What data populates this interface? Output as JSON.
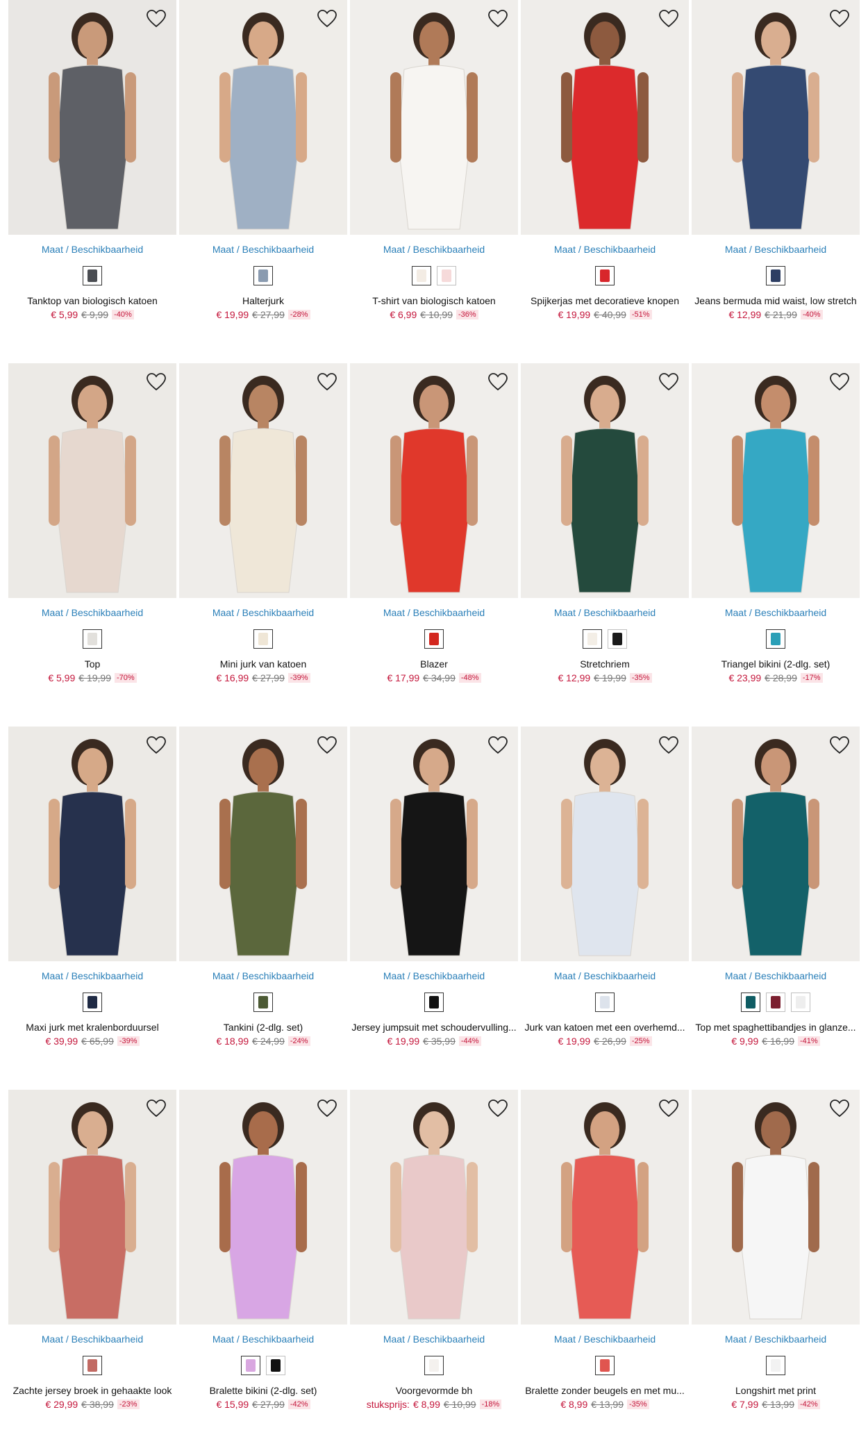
{
  "size_label": "Maat / Beschikbaarheid",
  "products": [
    {
      "name": "Tanktop van biologisch katoen",
      "price": "€ 5,99",
      "old_price": "€ 9,99",
      "discount": "-40%",
      "swatches": [
        "#4a4d52"
      ],
      "bg": "#e9e7e4",
      "fig": "#5e6066",
      "skin": "#c99a7a"
    },
    {
      "name": "Halterjurk",
      "price": "€ 19,99",
      "old_price": "€ 27,99",
      "discount": "-28%",
      "swatches": [
        "#8a9bb0"
      ],
      "bg": "#efede9",
      "fig": "#9fb0c4",
      "skin": "#d7a988"
    },
    {
      "name": "T-shirt van biologisch katoen",
      "price": "€ 6,99",
      "old_price": "€ 10,99",
      "discount": "-36%",
      "swatches": [
        "#f3ece4",
        "#f6dada"
      ],
      "bg": "#f0eeeb",
      "fig": "#f7f5f2",
      "skin": "#b07a58"
    },
    {
      "name": "Spijkerjas met decoratieve knopen",
      "price": "€ 19,99",
      "old_price": "€ 40,99",
      "discount": "-51%",
      "swatches": [
        "#d8262b"
      ],
      "bg": "#efedea",
      "fig": "#dc2a2c",
      "skin": "#8d5a3f"
    },
    {
      "name": "Jeans bermuda mid waist, low stretch",
      "price": "€ 12,99",
      "old_price": "€ 21,99",
      "discount": "-40%",
      "swatches": [
        "#2d3e63"
      ],
      "bg": "#efedea",
      "fig": "#344a72",
      "skin": "#d9ae90"
    },
    {
      "name": "Top",
      "price": "€ 5,99",
      "old_price": "€ 19,99",
      "discount": "-70%",
      "swatches": [
        "#e2e0dc"
      ],
      "bg": "#eceae6",
      "fig": "#e6d8cf",
      "skin": "#d3a687"
    },
    {
      "name": "Mini jurk van katoen",
      "price": "€ 16,99",
      "old_price": "€ 27,99",
      "discount": "-39%",
      "swatches": [
        "#efe6d6"
      ],
      "bg": "#efedea",
      "fig": "#efe7d8",
      "skin": "#b88563"
    },
    {
      "name": "Blazer",
      "price": "€ 17,99",
      "old_price": "€ 34,99",
      "discount": "-48%",
      "swatches": [
        "#d3271f"
      ],
      "bg": "#f0eeeb",
      "fig": "#e0382b",
      "skin": "#c99677"
    },
    {
      "name": "Stretchriem",
      "price": "€ 12,99",
      "old_price": "€ 19,99",
      "discount": "-35%",
      "swatches": [
        "#f3eee6",
        "#1a1a1a"
      ],
      "bg": "#efedea",
      "fig": "#244a3d",
      "skin": "#d8ac8e"
    },
    {
      "name": "Triangel bikini (2-dlg. set)",
      "price": "€ 23,99",
      "old_price": "€ 28,99",
      "discount": "-17%",
      "swatches": [
        "#2a9fb7"
      ],
      "bg": "#f1efec",
      "fig": "#35a8c4",
      "skin": "#c48d6c"
    },
    {
      "name": "Maxi jurk met kralenborduursel",
      "price": "€ 39,99",
      "old_price": "€ 65,99",
      "discount": "-39%",
      "swatches": [
        "#1f2a44"
      ],
      "bg": "#eceae6",
      "fig": "#26314d",
      "skin": "#d6a988"
    },
    {
      "name": "Tankini (2-dlg. set)",
      "price": "€ 18,99",
      "old_price": "€ 24,99",
      "discount": "-24%",
      "swatches": [
        "#4c5a34"
      ],
      "bg": "#efedea",
      "fig": "#5b673c",
      "skin": "#a9704e"
    },
    {
      "name": "Jersey jumpsuit met schoudervulling...",
      "price": "€ 19,99",
      "old_price": "€ 35,99",
      "discount": "-44%",
      "swatches": [
        "#111111"
      ],
      "bg": "#f0eeeb",
      "fig": "#151515",
      "skin": "#d6a98a"
    },
    {
      "name": "Jurk van katoen met een overhemd...",
      "price": "€ 19,99",
      "old_price": "€ 26,99",
      "discount": "-25%",
      "swatches": [
        "#dde3ec"
      ],
      "bg": "#efedea",
      "fig": "#dfe5ee",
      "skin": "#dcb395"
    },
    {
      "name": "Top met spaghettibandjes in glanze...",
      "price": "€ 9,99",
      "old_price": "€ 16,99",
      "discount": "-41%",
      "swatches": [
        "#0f5c63",
        "#7b1f2f",
        "#eeeeee"
      ],
      "bg": "#efedea",
      "fig": "#136169",
      "skin": "#c99677"
    },
    {
      "name": "Zachte jersey broek in gehaakte look",
      "price": "€ 29,99",
      "old_price": "€ 38,99",
      "discount": "-23%",
      "swatches": [
        "#c26a63"
      ],
      "bg": "#eceae6",
      "fig": "#c86d64",
      "skin": "#d9ae90"
    },
    {
      "name": "Bralette bikini (2-dlg. set)",
      "price": "€ 15,99",
      "old_price": "€ 27,99",
      "discount": "-42%",
      "swatches": [
        "#d9a7e0",
        "#111111"
      ],
      "bg": "#efedea",
      "fig": "#d8a6e4",
      "skin": "#a86c4b"
    },
    {
      "name": "Voorgevormde bh",
      "prefix": "stuksprijs:",
      "price": "€ 8,99",
      "old_price": "€ 10,99",
      "discount": "-18%",
      "swatches": [
        "#f4f1ee"
      ],
      "bg": "#f0eeeb",
      "fig": "#e9c9c9",
      "skin": "#e2bea4"
    },
    {
      "name": "Bralette zonder beugels en met mu...",
      "price": "€ 8,99",
      "old_price": "€ 13,99",
      "discount": "-35%",
      "swatches": [
        "#e0554f"
      ],
      "bg": "#efedea",
      "fig": "#e65b55",
      "skin": "#d3a282"
    },
    {
      "name": "Longshirt met print",
      "price": "€ 7,99",
      "old_price": "€ 13,99",
      "discount": "-42%",
      "swatches": [
        "#f2f2f2"
      ],
      "bg": "#f1efec",
      "fig": "#f6f6f6",
      "skin": "#a06a4c"
    }
  ]
}
